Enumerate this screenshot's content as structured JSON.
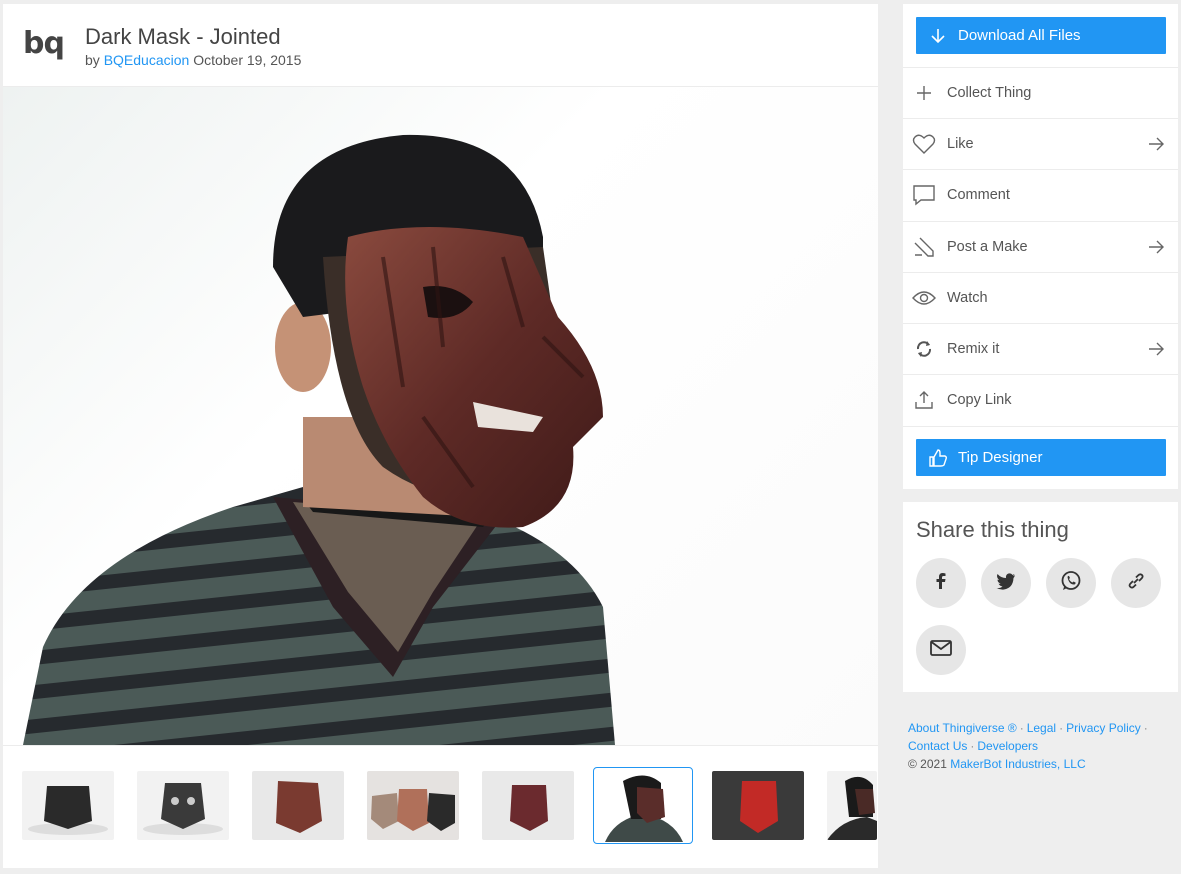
{
  "thing": {
    "logo_text": "bq",
    "title": "Dark Mask - Jointed",
    "by_prefix": "by",
    "author": "BQEducacion",
    "date": "October 19, 2015"
  },
  "gallery": {
    "thumbnails": [
      {
        "name": "thumb-1",
        "bg": "#f2f2f2",
        "mask": "#2a2a2a"
      },
      {
        "name": "thumb-2",
        "bg": "#f2f2f2",
        "mask": "#3a3a3a"
      },
      {
        "name": "thumb-3",
        "bg": "#e8e8e8",
        "mask": "#7a3a30"
      },
      {
        "name": "thumb-4",
        "bg": "#e5e2e0",
        "mask": "#8e5a48"
      },
      {
        "name": "thumb-5",
        "bg": "#e9e9e9",
        "mask": "#6b2a2e"
      },
      {
        "name": "thumb-6",
        "bg": "#ffffff",
        "mask": "#5a2d2a"
      },
      {
        "name": "thumb-7",
        "bg": "#3a3a3a",
        "mask": "#c22a26"
      },
      {
        "name": "thumb-8",
        "bg": "#f2f2f2",
        "mask": "#4a2a26"
      }
    ]
  },
  "actions": {
    "download_label": "Download All Files",
    "collect_label": "Collect Thing",
    "like_label": "Like",
    "comment_label": "Comment",
    "post_make_label": "Post a Make",
    "watch_label": "Watch",
    "remix_label": "Remix it",
    "copy_link_label": "Copy Link",
    "tip_label": "Tip Designer"
  },
  "share": {
    "title": "Share this thing",
    "buttons": [
      "facebook-icon",
      "twitter-icon",
      "whatsapp-icon",
      "link-icon",
      "mail-icon"
    ]
  },
  "footer": {
    "about": "About Thingiverse",
    "registered": "®",
    "legal": "Legal",
    "privacy": "Privacy Policy",
    "contact": "Contact Us",
    "developers": "Developers",
    "copyright_prefix": "© 2021",
    "company": "MakerBot Industries, LLC"
  },
  "colors": {
    "accent": "#2196f3",
    "page_bg": "#eeeeee",
    "card_bg": "#ffffff"
  }
}
